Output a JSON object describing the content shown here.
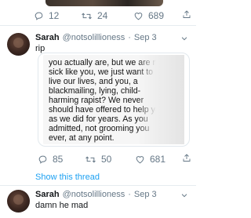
{
  "prev_tweet": {
    "actions": {
      "replies": "12",
      "retweets": "24",
      "likes": "689"
    }
  },
  "tweet1": {
    "name": "Sarah",
    "handle": "@notsolillioness",
    "dot": "·",
    "date": "Sep 3",
    "text": "rip",
    "quote_lines": [
      "you actually are, but we are not",
      "sick like you, we just want to",
      "live our lives, and you, a",
      "blackmailing, lying, child-",
      "harming rapist? We never",
      "should have offered to help you",
      "as we did for years. As you",
      "admitted, not grooming you",
      "ever, at any point."
    ],
    "actions": {
      "replies": "85",
      "retweets": "50",
      "likes": "681"
    },
    "show_thread": "Show this thread"
  },
  "tweet2": {
    "name": "Sarah",
    "handle": "@notsolillioness",
    "dot": "·",
    "date": "Sep 3",
    "text": "damn he mad"
  },
  "colors": {
    "accent": "#1da1f2",
    "muted": "#657786",
    "text": "#14171a",
    "border": "#e1e8ed"
  },
  "icons": [
    "reply-icon",
    "retweet-icon",
    "like-icon",
    "share-icon",
    "chevron-down-icon"
  ]
}
